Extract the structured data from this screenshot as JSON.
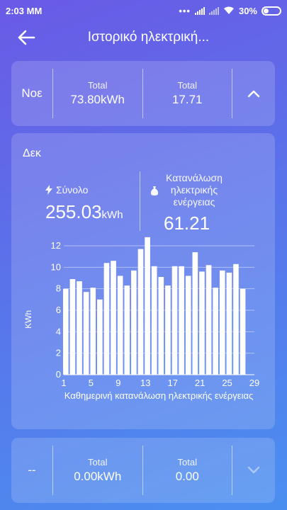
{
  "status_bar": {
    "time": "2:03 MM",
    "battery": "30%"
  },
  "header": {
    "title": "Ιστορικό ηλεκτρική..."
  },
  "previous_month": {
    "month": "Νοε",
    "total_energy_label": "Total",
    "total_energy_value": "73.80kWh",
    "total_cost_label": "Total",
    "total_cost_value": "17.71",
    "toggle_icon": "chevron-up-icon"
  },
  "current_month": {
    "month": "Δεκ",
    "sum_label": "Σύνολο",
    "sum_value": "255.03",
    "sum_unit": "kWh",
    "consumption_label": "Κατανάλωση ηλεκτρικής ενέργειας",
    "consumption_value": "61.21"
  },
  "next_month": {
    "month": "--",
    "total_energy_label": "Total",
    "total_energy_value": "0.00kWh",
    "total_cost_label": "Total",
    "total_cost_value": "0.00",
    "toggle_icon": "chevron-down-icon"
  },
  "chart_data": {
    "type": "bar",
    "xlabel": "Καθημερινή κατανάλωση ηλεκτρικής ενέργειας",
    "ylabel": "KWh",
    "x": [
      1,
      2,
      3,
      4,
      5,
      6,
      7,
      8,
      9,
      10,
      11,
      12,
      13,
      14,
      15,
      16,
      17,
      18,
      19,
      20,
      21,
      22,
      23,
      24,
      25,
      26,
      27
    ],
    "values": [
      8.0,
      8.9,
      8.7,
      7.7,
      8.1,
      7.0,
      10.4,
      10.6,
      9.2,
      8.3,
      9.7,
      11.7,
      12.8,
      10.1,
      9.1,
      8.3,
      10.1,
      10.1,
      9.2,
      11.4,
      9.6,
      10.2,
      8.1,
      9.7,
      9.5,
      10.3,
      8.0
    ],
    "x_ticks": [
      1,
      5,
      9,
      13,
      17,
      21,
      25,
      29
    ],
    "y_ticks": [
      0,
      2,
      4,
      6,
      8,
      10,
      12
    ],
    "xlim": [
      1,
      29
    ],
    "ylim": [
      0,
      12
    ],
    "grid": true,
    "bar_color": "#ffffff"
  }
}
